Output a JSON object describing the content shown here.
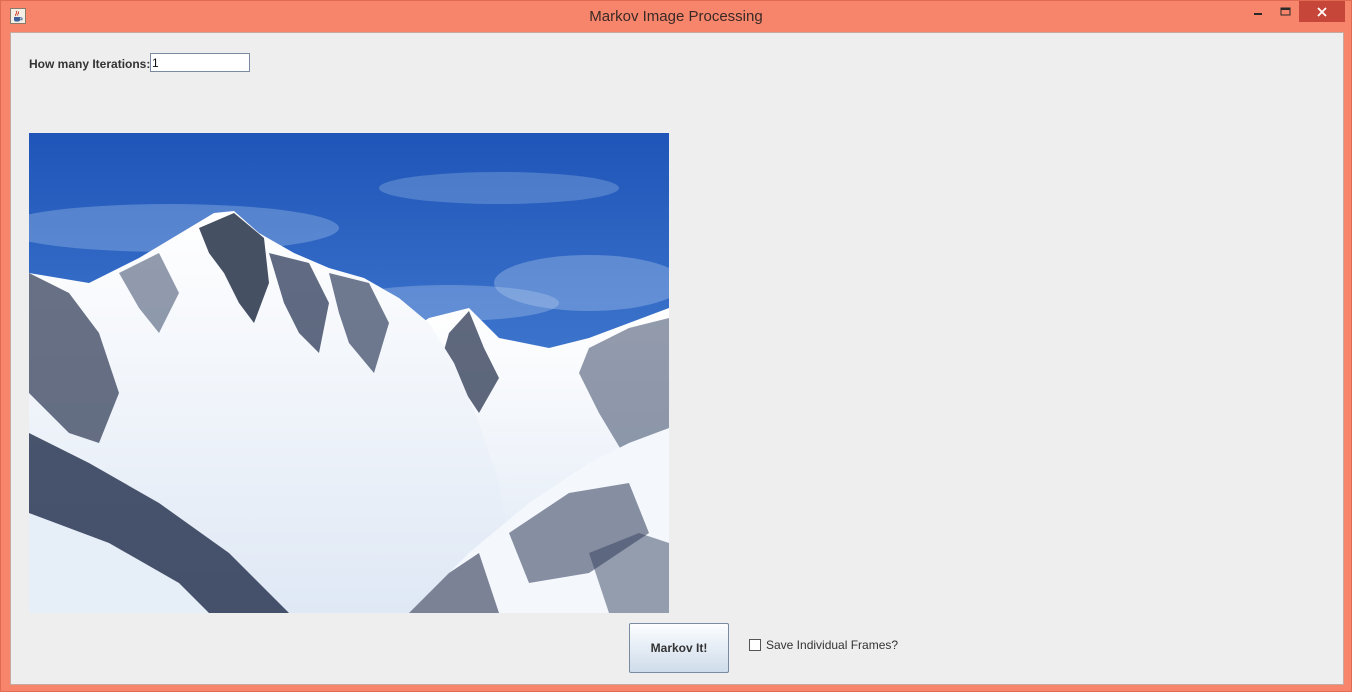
{
  "window": {
    "title": "Markov Image Processing",
    "accent_color": "#f6856c",
    "close_color": "#c7463a"
  },
  "form": {
    "iterations_label": "How many Iterations:",
    "iterations_value": "1"
  },
  "image": {
    "subject": "snowy-mountain-photo"
  },
  "actions": {
    "markov_label": "Markov It!",
    "save_frames_label": "Save Individual Frames?",
    "save_frames_checked": false
  },
  "icons": {
    "app": "java-coffee-cup-icon",
    "minimize": "minimize-icon",
    "maximize": "maximize-icon",
    "close": "close-icon"
  }
}
